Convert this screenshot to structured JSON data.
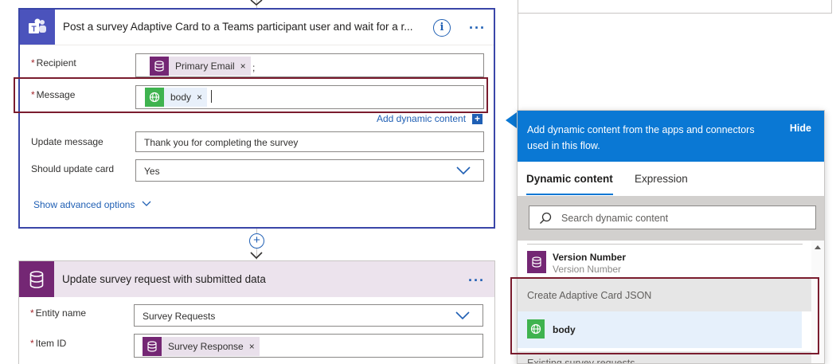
{
  "card1": {
    "title": "Post a survey Adaptive Card to a Teams participant user and wait for a r...",
    "info_glyph": "i",
    "menu_glyph": "···",
    "recipient_label": "Recipient",
    "recipient_token": "Primary Email",
    "recipient_suffix": ";",
    "message_label": "Message",
    "message_token": "body",
    "add_dynamic_label": "Add dynamic content",
    "add_dynamic_glyph": "+",
    "update_message_label": "Update message",
    "update_message_value": "Thank you for completing the survey",
    "should_update_label": "Should update card",
    "should_update_value": "Yes",
    "show_advanced_label": "Show advanced options"
  },
  "card2": {
    "title": "Update survey request with submitted data",
    "menu_glyph": "···",
    "entity_label": "Entity name",
    "entity_value": "Survey Requests",
    "item_label": "Item ID",
    "item_token": "Survey Response"
  },
  "required_mark": "*",
  "remove_glyph": "×",
  "add_step_glyph": "+",
  "panel": {
    "header_text": "Add dynamic content from the apps and connectors used in this flow.",
    "hide_label": "Hide",
    "tab_dynamic": "Dynamic content",
    "tab_expression": "Expression",
    "search_placeholder": "Search dynamic content",
    "item_version_title": "Version Number",
    "item_version_sub": "Version Number",
    "section_title": "Create Adaptive Card JSON",
    "item_body": "body",
    "section_next": "Existing survey requests"
  },
  "colors": {
    "teams": "#4b53bc",
    "dataverse": "#742774",
    "http": "#3fb34f",
    "accent": "#0a78d4",
    "highlight": "#7a1c2e"
  }
}
